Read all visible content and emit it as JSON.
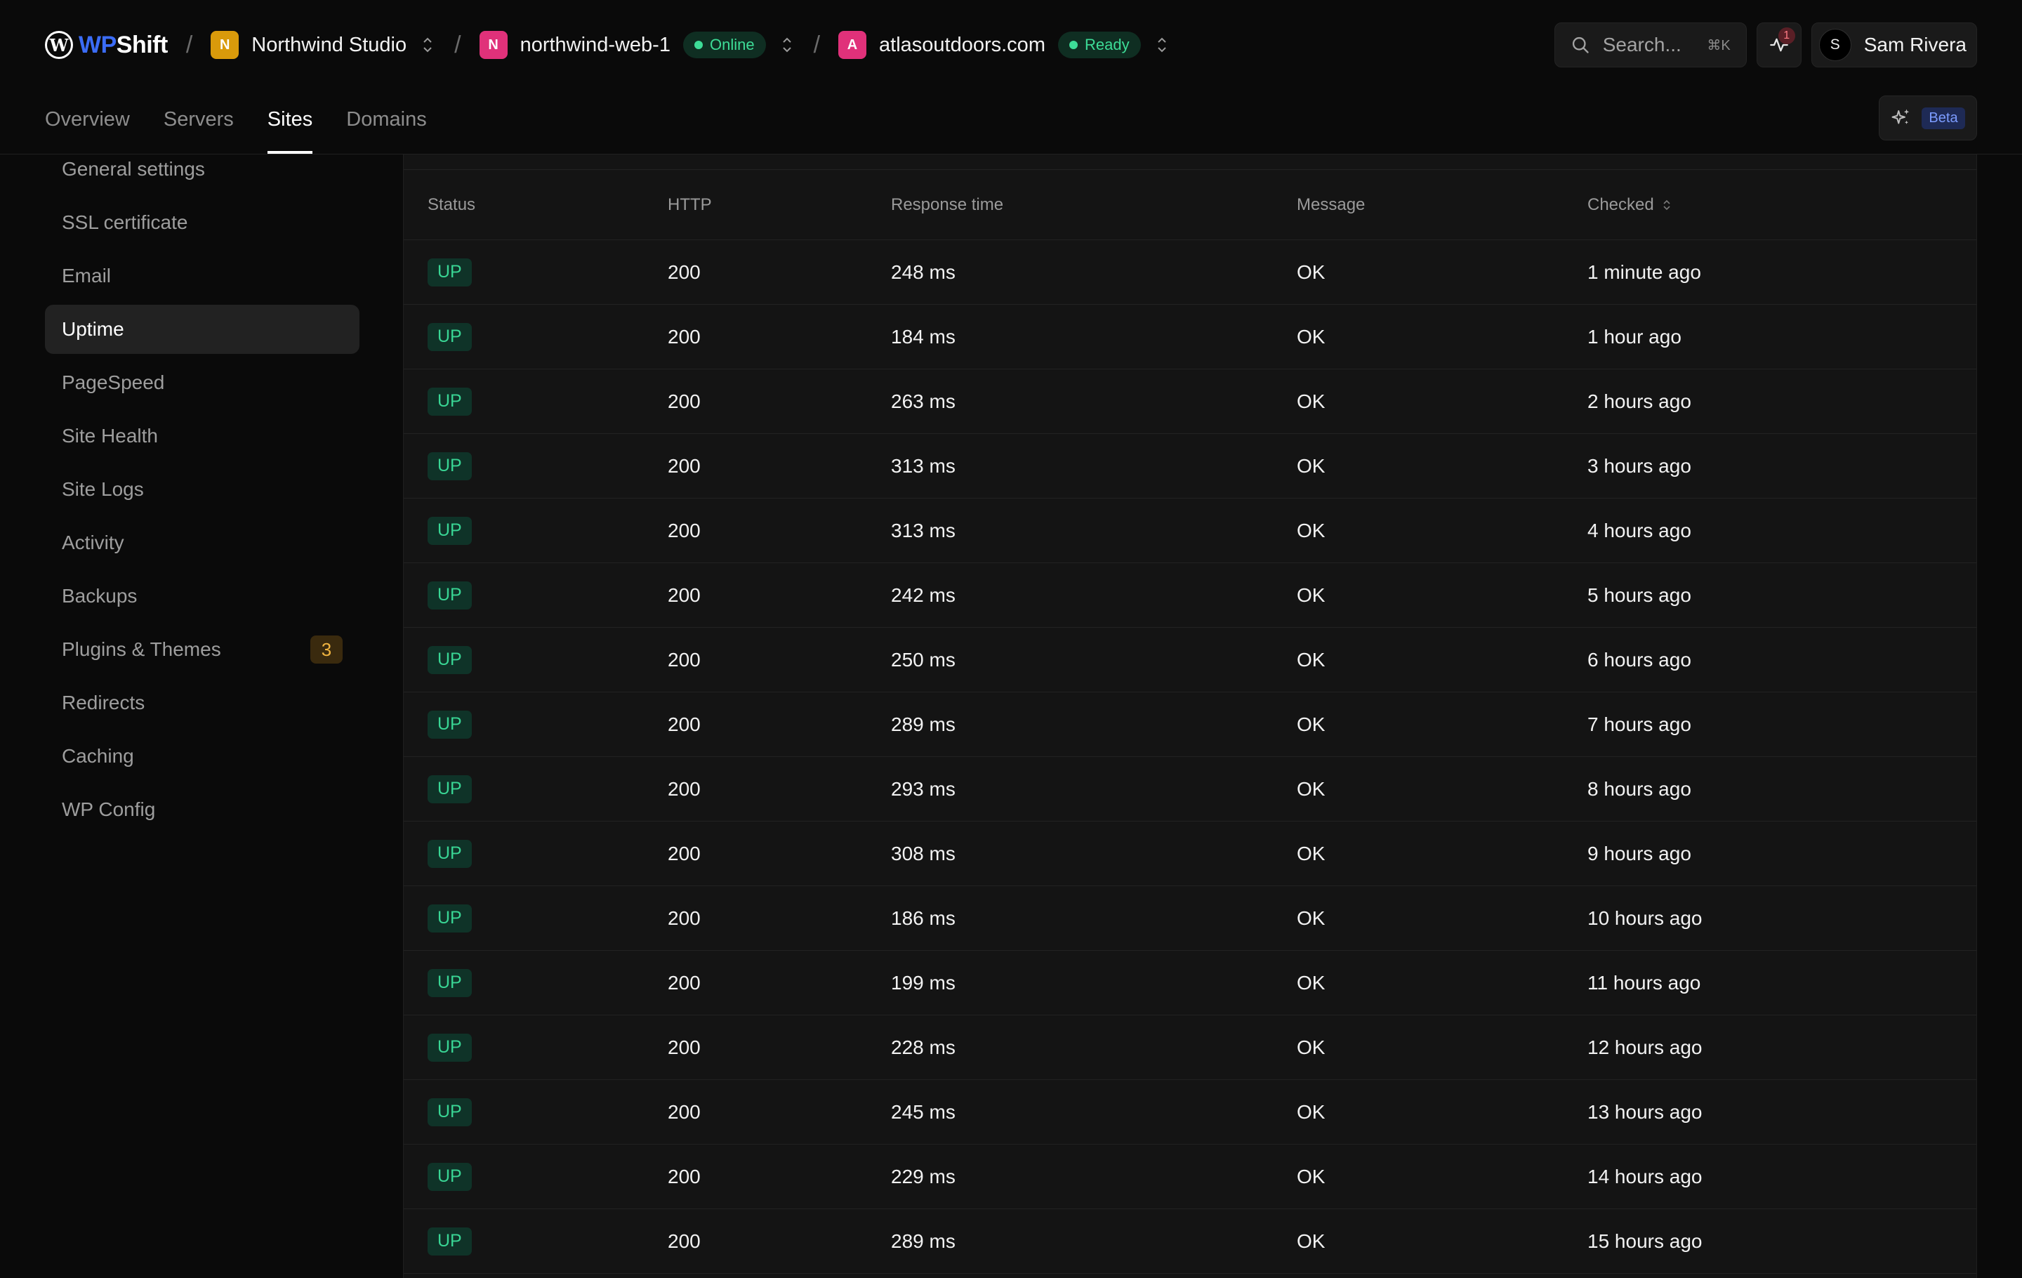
{
  "brand": {
    "wp": "WP",
    "shift": "Shift",
    "mark_letter": "W"
  },
  "breadcrumb": {
    "separator": "/",
    "team": {
      "initial": "N",
      "label": "Northwind Studio",
      "color": "#d99a0b"
    },
    "server": {
      "initial": "N",
      "label": "northwind-web-1",
      "status": "Online",
      "color": "#e0317a"
    },
    "site": {
      "initial": "A",
      "label": "atlasoutdoors.com",
      "status": "Ready",
      "color": "#e0317a"
    }
  },
  "search": {
    "label": "Search...",
    "shortcut": "⌘K"
  },
  "notifications": {
    "count": "1"
  },
  "user": {
    "initial": "S",
    "name": "Sam Rivera"
  },
  "tabs": [
    {
      "label": "Overview",
      "active": false
    },
    {
      "label": "Servers",
      "active": false
    },
    {
      "label": "Sites",
      "active": true
    },
    {
      "label": "Domains",
      "active": false
    }
  ],
  "ai": {
    "beta_label": "Beta"
  },
  "sidebar": {
    "items": [
      {
        "label": "General settings"
      },
      {
        "label": "SSL certificate"
      },
      {
        "label": "Email"
      },
      {
        "label": "Uptime",
        "active": true
      },
      {
        "label": "PageSpeed"
      },
      {
        "label": "Site Health"
      },
      {
        "label": "Site Logs"
      },
      {
        "label": "Activity"
      },
      {
        "label": "Backups"
      },
      {
        "label": "Plugins & Themes",
        "badge": "3"
      },
      {
        "label": "Redirects"
      },
      {
        "label": "Caching"
      },
      {
        "label": "WP Config"
      }
    ]
  },
  "uptime_table": {
    "columns": [
      "Status",
      "HTTP",
      "Response time",
      "Message",
      "Checked"
    ],
    "rows": [
      {
        "status": "UP",
        "http": "200",
        "response": "248 ms",
        "message": "OK",
        "checked": "1 minute ago"
      },
      {
        "status": "UP",
        "http": "200",
        "response": "184 ms",
        "message": "OK",
        "checked": "1 hour ago"
      },
      {
        "status": "UP",
        "http": "200",
        "response": "263 ms",
        "message": "OK",
        "checked": "2 hours ago"
      },
      {
        "status": "UP",
        "http": "200",
        "response": "313 ms",
        "message": "OK",
        "checked": "3 hours ago"
      },
      {
        "status": "UP",
        "http": "200",
        "response": "313 ms",
        "message": "OK",
        "checked": "4 hours ago"
      },
      {
        "status": "UP",
        "http": "200",
        "response": "242 ms",
        "message": "OK",
        "checked": "5 hours ago"
      },
      {
        "status": "UP",
        "http": "200",
        "response": "250 ms",
        "message": "OK",
        "checked": "6 hours ago"
      },
      {
        "status": "UP",
        "http": "200",
        "response": "289 ms",
        "message": "OK",
        "checked": "7 hours ago"
      },
      {
        "status": "UP",
        "http": "200",
        "response": "293 ms",
        "message": "OK",
        "checked": "8 hours ago"
      },
      {
        "status": "UP",
        "http": "200",
        "response": "308 ms",
        "message": "OK",
        "checked": "9 hours ago"
      },
      {
        "status": "UP",
        "http": "200",
        "response": "186 ms",
        "message": "OK",
        "checked": "10 hours ago"
      },
      {
        "status": "UP",
        "http": "200",
        "response": "199 ms",
        "message": "OK",
        "checked": "11 hours ago"
      },
      {
        "status": "UP",
        "http": "200",
        "response": "228 ms",
        "message": "OK",
        "checked": "12 hours ago"
      },
      {
        "status": "UP",
        "http": "200",
        "response": "245 ms",
        "message": "OK",
        "checked": "13 hours ago"
      },
      {
        "status": "UP",
        "http": "200",
        "response": "229 ms",
        "message": "OK",
        "checked": "14 hours ago"
      },
      {
        "status": "UP",
        "http": "200",
        "response": "289 ms",
        "message": "OK",
        "checked": "15 hours ago"
      }
    ]
  }
}
